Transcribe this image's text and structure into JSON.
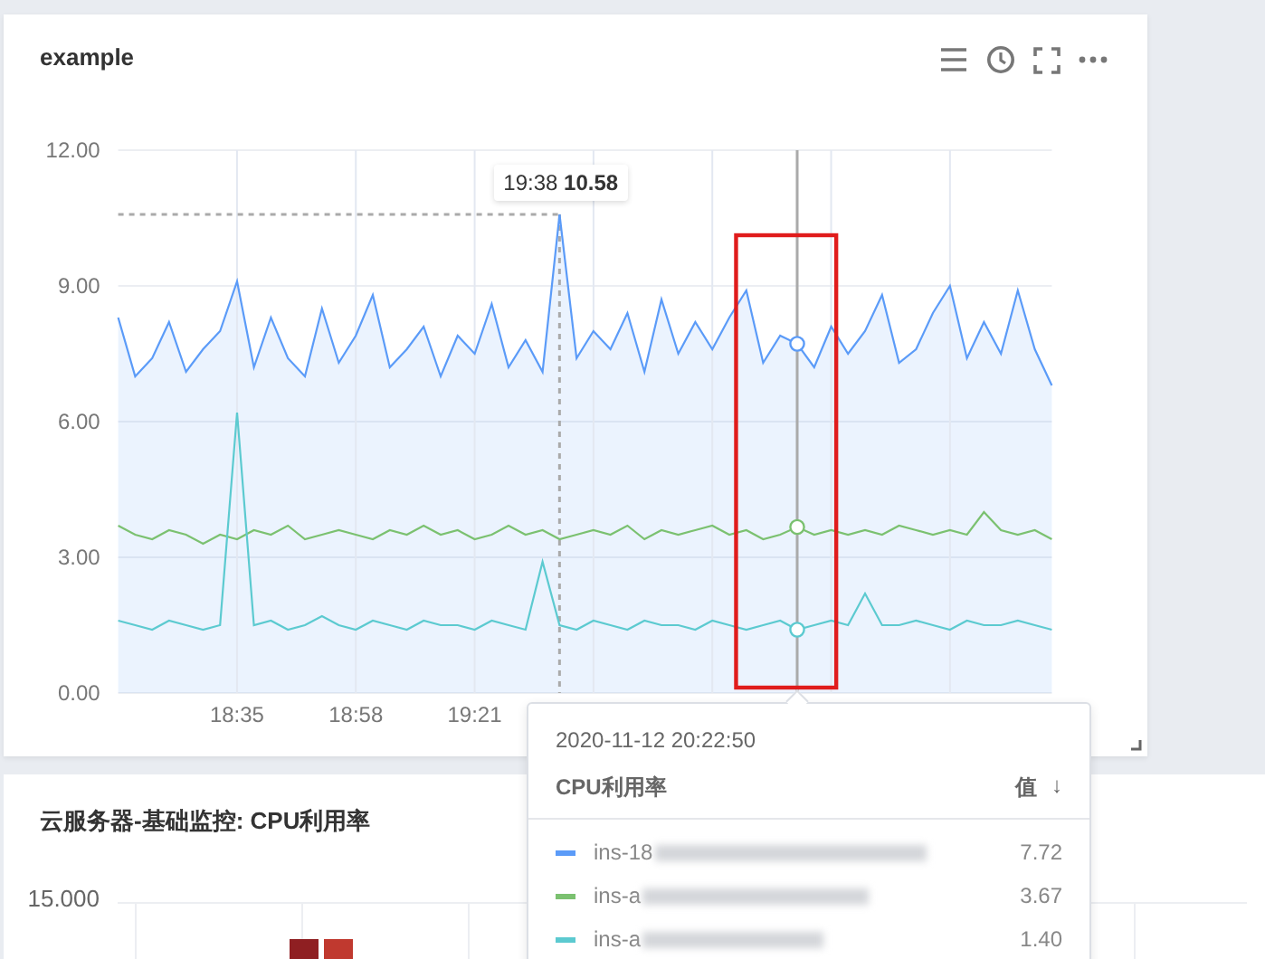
{
  "main_card": {
    "title": "example",
    "chart_data": {
      "type": "line",
      "grid": true,
      "categories": [
        null,
        null,
        null,
        null,
        null,
        null,
        null,
        "18:35",
        null,
        null,
        null,
        null,
        null,
        null,
        "18:58",
        null,
        null,
        null,
        null,
        null,
        null,
        "19:21",
        null,
        null,
        null,
        null,
        null,
        null,
        null,
        null,
        null,
        null,
        null,
        null,
        null,
        null,
        null,
        null,
        null,
        null,
        null,
        null,
        null,
        null,
        null,
        null,
        null,
        null,
        null,
        null,
        null,
        null,
        null,
        null,
        null,
        null
      ],
      "series": [
        {
          "name": "ins-18",
          "color": "#5b9bf8",
          "type": "area",
          "values": [
            8.3,
            7.0,
            7.4,
            8.2,
            7.1,
            7.6,
            8.0,
            9.1,
            7.2,
            8.3,
            7.4,
            7.0,
            8.5,
            7.3,
            7.9,
            8.8,
            7.2,
            7.6,
            8.1,
            7.0,
            7.9,
            7.5,
            8.6,
            7.2,
            7.8,
            7.1,
            10.58,
            7.4,
            8.0,
            7.6,
            8.4,
            7.1,
            8.7,
            7.5,
            8.2,
            7.6,
            8.3,
            8.9,
            7.3,
            7.9,
            7.72,
            7.2,
            8.1,
            7.5,
            8.0,
            8.8,
            7.3,
            7.6,
            8.4,
            9.0,
            7.4,
            8.2,
            7.5,
            8.9,
            7.6,
            6.8
          ]
        },
        {
          "name": "ins-a",
          "color": "#7bc170",
          "type": "line",
          "values": [
            3.7,
            3.5,
            3.4,
            3.6,
            3.5,
            3.3,
            3.5,
            3.4,
            3.6,
            3.5,
            3.7,
            3.4,
            3.5,
            3.6,
            3.5,
            3.4,
            3.6,
            3.5,
            3.7,
            3.5,
            3.6,
            3.4,
            3.5,
            3.7,
            3.5,
            3.6,
            3.4,
            3.5,
            3.6,
            3.5,
            3.7,
            3.4,
            3.6,
            3.5,
            3.6,
            3.7,
            3.5,
            3.6,
            3.4,
            3.5,
            3.67,
            3.5,
            3.6,
            3.5,
            3.6,
            3.5,
            3.7,
            3.6,
            3.5,
            3.6,
            3.5,
            4.0,
            3.6,
            3.5,
            3.6,
            3.4
          ]
        },
        {
          "name": "ins-a",
          "color": "#5ccad0",
          "type": "line",
          "values": [
            1.6,
            1.5,
            1.4,
            1.6,
            1.5,
            1.4,
            1.5,
            6.2,
            1.5,
            1.6,
            1.4,
            1.5,
            1.7,
            1.5,
            1.4,
            1.6,
            1.5,
            1.4,
            1.6,
            1.5,
            1.5,
            1.4,
            1.6,
            1.5,
            1.4,
            2.9,
            1.5,
            1.4,
            1.6,
            1.5,
            1.4,
            1.6,
            1.5,
            1.5,
            1.4,
            1.6,
            1.5,
            1.4,
            1.5,
            1.6,
            1.4,
            1.5,
            1.6,
            1.5,
            2.2,
            1.5,
            1.5,
            1.6,
            1.5,
            1.4,
            1.6,
            1.5,
            1.5,
            1.6,
            1.5,
            1.4
          ]
        }
      ],
      "ylim": [
        0,
        12
      ],
      "yticks": [
        {
          "value": 0,
          "label": "0.00"
        },
        {
          "value": 3,
          "label": "3.00"
        },
        {
          "value": 6,
          "label": "6.00"
        },
        {
          "value": 9,
          "label": "9.00"
        },
        {
          "value": 12,
          "label": "12.00"
        }
      ]
    },
    "max_label": {
      "time": "19:38",
      "value": "10.58"
    },
    "tooltip": {
      "time": "2020-11-12 20:22:50",
      "metric": "CPU利用率",
      "value_header": "值",
      "sort_icon": "↓",
      "rows": [
        {
          "value": "7.72"
        },
        {
          "value": "3.67"
        },
        {
          "value": "1.40"
        }
      ]
    }
  },
  "second_card": {
    "title": "云服务器-基础监控: CPU利用率",
    "y_labels": [
      "15.000"
    ]
  }
}
